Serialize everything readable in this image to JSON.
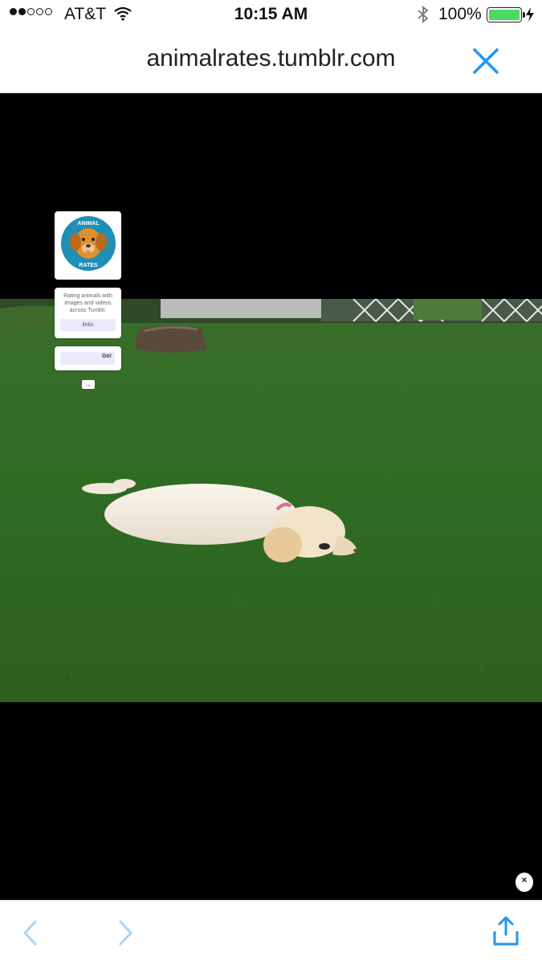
{
  "status_bar": {
    "carrier": "AT&T",
    "time": "10:15 AM",
    "battery_percent": "100%",
    "signal_dots_filled": 2,
    "signal_dots_total": 5,
    "battery_color": "#4cd964",
    "icons": [
      "wifi-icon",
      "bluetooth-icon",
      "battery-icon",
      "charging-bolt-icon"
    ]
  },
  "browser": {
    "url": "animalrates.tumblr.com",
    "accent_color": "#2196f3",
    "close_icon": "close-x-icon"
  },
  "page": {
    "logo_text_top": "ANIMAL",
    "logo_text_bottom": "RATES",
    "description": "Rating animals with images and videos across Tumblr.",
    "links_label": "links",
    "go_label": "Go!",
    "arrow_label": "→",
    "dismiss_label": "×"
  },
  "toolbar": {
    "back_icon": "chevron-left-icon",
    "forward_icon": "chevron-right-icon",
    "share_icon": "share-icon"
  }
}
